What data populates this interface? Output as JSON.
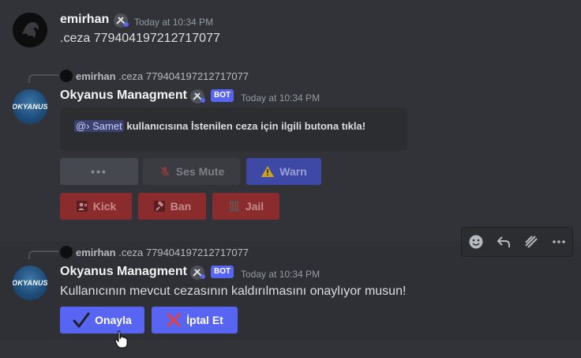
{
  "messages": [
    {
      "username": "emirhan",
      "timestamp": "Today at 10:34 PM",
      "content": ".ceza 779404197212717077"
    },
    {
      "reply": {
        "username": "emirhan",
        "content": ".ceza 779404197212717077"
      },
      "username": "Okyanus Managment",
      "bot_tag": "BOT",
      "timestamp": "Today at 10:34 PM",
      "embed": {
        "mention": "@› Samet",
        "text": "kullanıcısına İstenilen ceza için ilgili butona tıkla!"
      },
      "buttons_row1": [
        {
          "label": "•••"
        },
        {
          "label": "Ses Mute",
          "icon": "mic-off-icon"
        },
        {
          "label": "Warn",
          "icon": "warning-icon"
        }
      ],
      "buttons_row2": [
        {
          "label": "Kick",
          "icon": "kick-icon"
        },
        {
          "label": "Ban",
          "icon": "hammer-icon"
        },
        {
          "label": "Jail",
          "icon": "jail-icon"
        }
      ]
    },
    {
      "reply": {
        "username": "emirhan",
        "content": ".ceza 779404197212717077"
      },
      "username": "Okyanus Managment",
      "bot_tag": "BOT",
      "timestamp": "Today at 10:34 PM",
      "content": "Kullanıcının mevcut cezasının kaldırılmasını onaylıyor musun!",
      "buttons": [
        {
          "label": "Onayla",
          "icon": "check-icon"
        },
        {
          "label": "İptal Et",
          "icon": "cross-icon"
        }
      ]
    }
  ],
  "bot_avatar_text": "OKYANUS",
  "toolbar": [
    "add-reaction-icon",
    "reply-icon",
    "app-icon",
    "more-icon"
  ],
  "colors": {
    "blurple": "#5865f2",
    "background": "#313338",
    "danger_disabled": "#8a2b2e"
  }
}
